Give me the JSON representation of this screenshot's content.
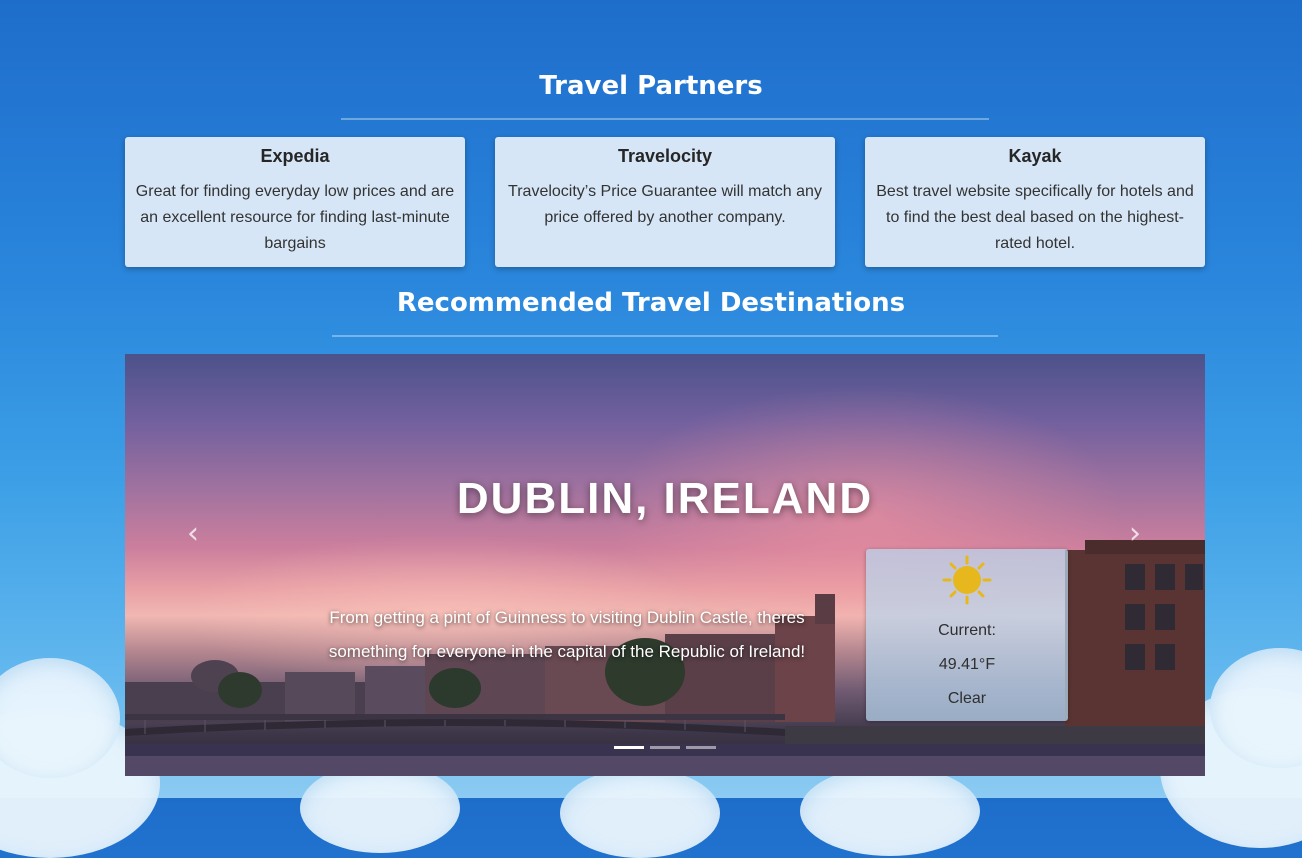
{
  "partners": {
    "heading": "Travel Partners",
    "cards": [
      {
        "title": "Expedia",
        "text": "Great for finding everyday low prices and are an excellent resource for finding last-minute bargains"
      },
      {
        "title": "Travelocity",
        "text": "Travelocity’s Price Guarantee will match any price offered by another company."
      },
      {
        "title": "Kayak",
        "text": "Best travel website specifically for hotels and to find the best deal based on the highest-rated hotel."
      }
    ]
  },
  "destinations": {
    "heading": "Recommended Travel Destinations",
    "slide": {
      "title": "DUBLIN, IRELAND",
      "description": "From getting a pint of Guinness to visiting Dublin Castle, theres something for everyone in the capital of the Republic of Ireland!"
    },
    "weather": {
      "icon": "sun-icon",
      "current_label": "Current:",
      "temperature": "49.41°F",
      "condition": "Clear"
    },
    "controls": {
      "prev_icon": "chevron-left-icon",
      "next_icon": "chevron-right-icon",
      "prev_glyph": "‹",
      "next_glyph": "›"
    },
    "indicators": {
      "count": 3,
      "active_index": 0
    }
  },
  "colors": {
    "accent_sun": "#e6b81e",
    "card_bg": "#d6e6f6",
    "indicator_active": "#ffffff",
    "indicator_inactive": "rgba(255,255,255,0.5)"
  }
}
